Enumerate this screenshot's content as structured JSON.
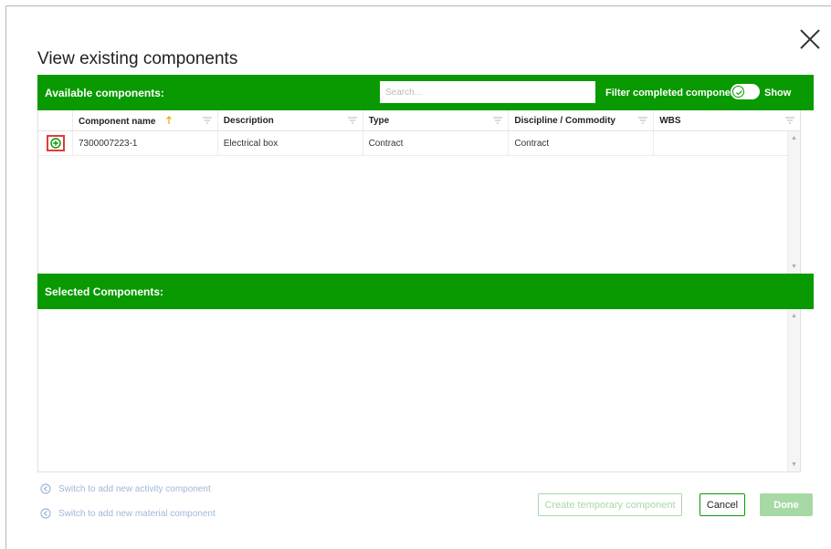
{
  "dialog": {
    "title": "View existing components"
  },
  "available": {
    "header_label": "Available components:",
    "search_placeholder": "Search...",
    "filter_label": "Filter completed components",
    "show_label": "Show",
    "toggle_on": true,
    "columns": [
      "Component name",
      "Description",
      "Type",
      "Discipline / Commodity",
      "WBS"
    ],
    "sort_column": "Component name",
    "rows": [
      {
        "name": "7300007223-1",
        "description": "Electrical box",
        "type": "Contract",
        "discipline": "Contract",
        "wbs": ""
      }
    ]
  },
  "selected": {
    "header_label": "Selected Components:"
  },
  "links": {
    "activity": "Switch to add new activity component",
    "material": "Switch to add new material component"
  },
  "buttons": {
    "temporary": "Create temporary component",
    "cancel": "Cancel",
    "done": "Done"
  },
  "colors": {
    "brand_green": "#089a00",
    "disabled_green": "#a7d9a5",
    "highlight_red": "#e23a3a",
    "link_blue": "#9eb8d8"
  },
  "icons": {
    "close": "close-icon",
    "add": "plus-circle-icon",
    "sort": "arrow-up-icon",
    "filter": "filter-icon",
    "check": "check-icon",
    "switch": "arrow-left-circle-icon"
  }
}
